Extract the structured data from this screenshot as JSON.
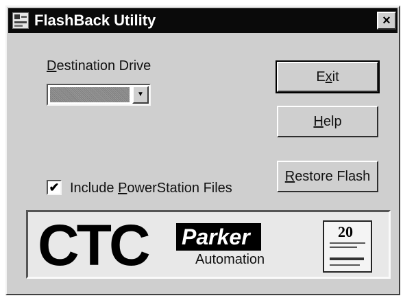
{
  "window": {
    "title": "FlashBack Utility",
    "close_label": "×"
  },
  "destination": {
    "label_first": "D",
    "label_rest": "estination Drive",
    "selected_value": ""
  },
  "buttons": {
    "exit": {
      "pre": "E",
      "mnemonic": "x",
      "post": "it"
    },
    "help": {
      "pre": "",
      "mnemonic": "H",
      "post": "elp"
    },
    "restore": {
      "pre": "",
      "mnemonic": "R",
      "post": "estore Flash"
    }
  },
  "include": {
    "checked": true,
    "check_mark": "✔",
    "label_pre": "Include ",
    "label_mnemonic": "P",
    "label_post": "owerStation Files"
  },
  "logos": {
    "ctc": "CTC",
    "parker": "Parker",
    "automation": "Automation",
    "compactflash_number": "20"
  }
}
